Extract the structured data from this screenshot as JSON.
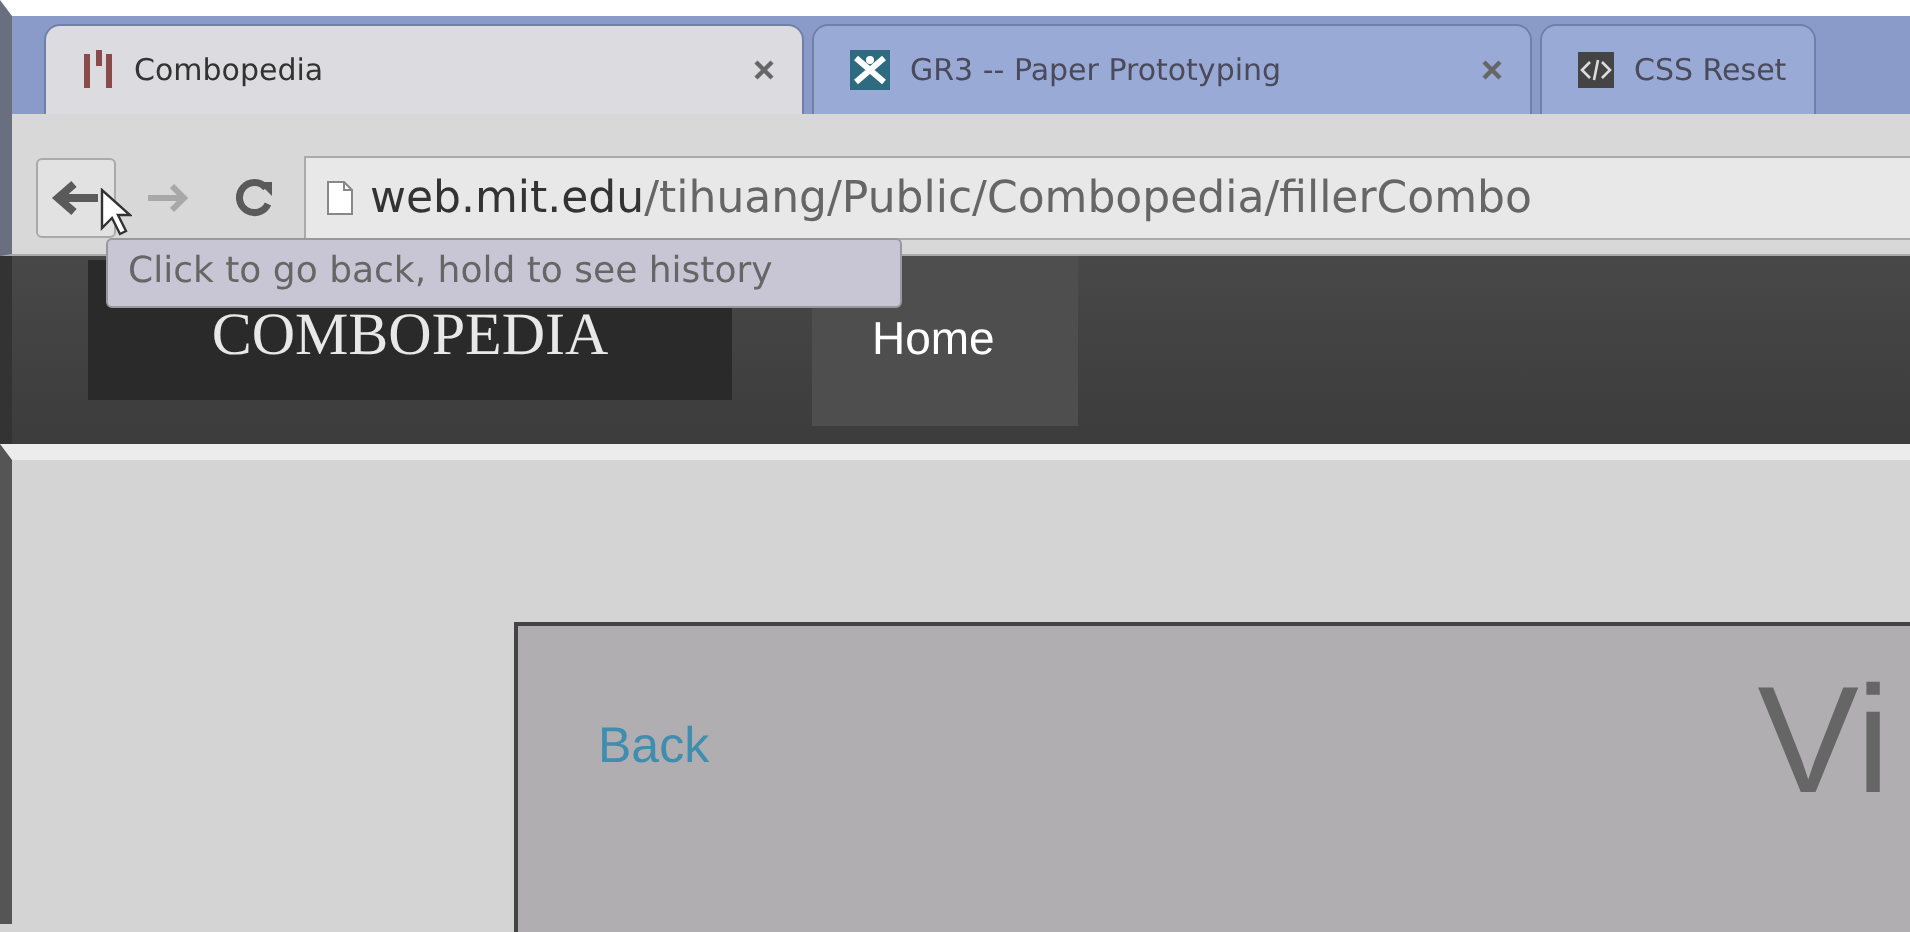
{
  "tabs": [
    {
      "title": "Combopedia",
      "kind": "bars",
      "selected": true,
      "closable": true
    },
    {
      "title": "GR3 -- Paper Prototyping",
      "kind": "figure",
      "selected": false,
      "closable": true
    },
    {
      "title": "CSS Reset",
      "kind": "code",
      "selected": false,
      "closable": false
    }
  ],
  "toolbar": {
    "url_domain": "web.mit.edu",
    "url_path": "/tihuang/Public/Combopedia/fillerCombo"
  },
  "tooltip": "Click to go back, hold to see history",
  "site": {
    "logo": "COMBOPEDIA",
    "nav": [
      {
        "label": "Home",
        "selected": true
      }
    ]
  },
  "panel": {
    "back_link": "Back",
    "heading": "Vi"
  }
}
